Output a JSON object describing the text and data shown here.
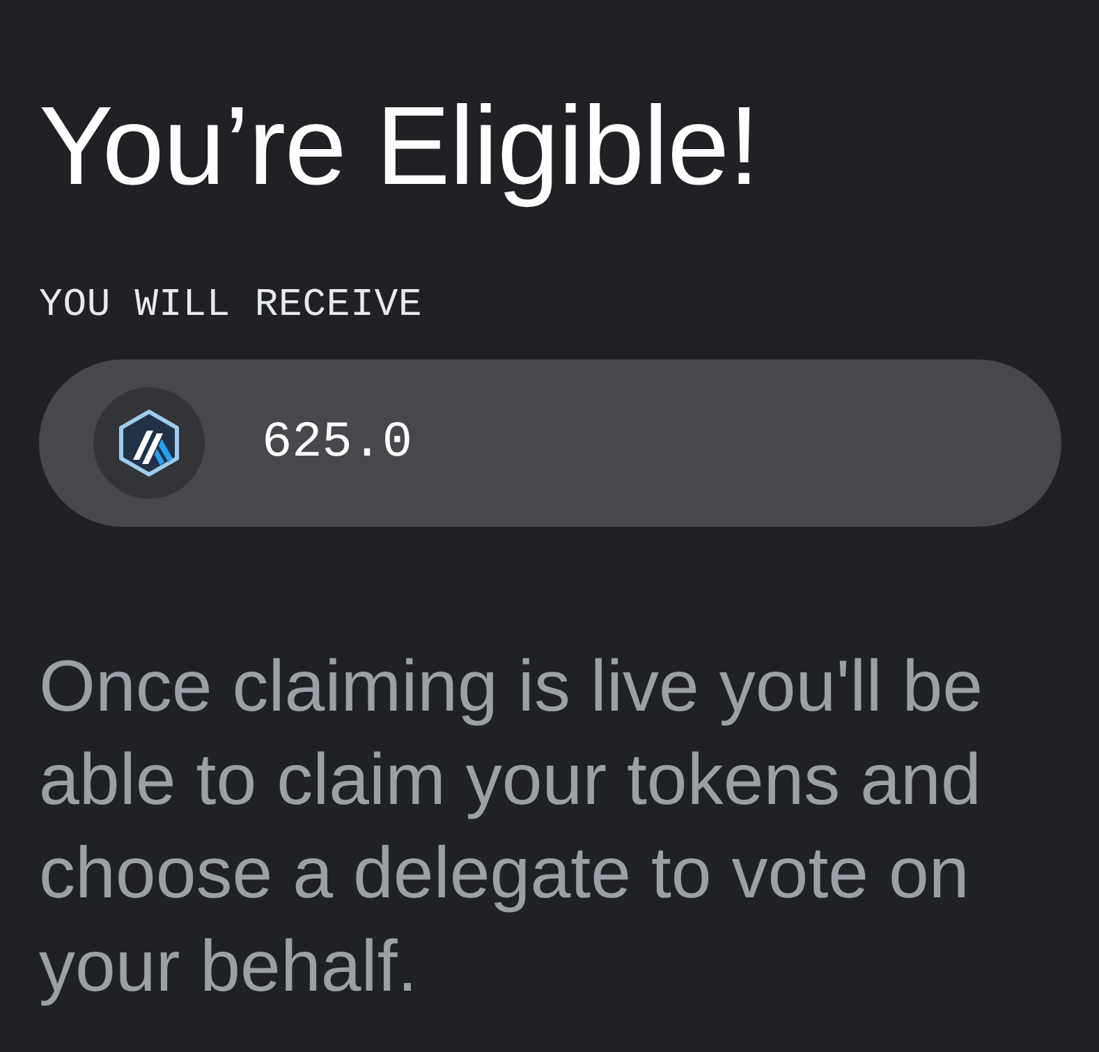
{
  "title": "You’re Eligible!",
  "receive": {
    "label": "YOU WILL RECEIVE",
    "amount": "625.0"
  },
  "description": "Once claiming is live you'll be able to claim your tokens and choose a delegate to vote on your behalf."
}
